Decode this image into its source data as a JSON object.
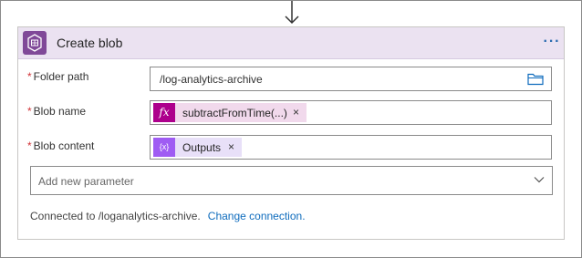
{
  "action": {
    "title": "Create blob",
    "icon": "storage-blob-icon",
    "menu_icon": "ellipsis-icon",
    "menu_label": "···"
  },
  "parameters": [
    {
      "required_marker": "*",
      "label": "Folder path",
      "value": "/log-analytics-archive",
      "icon": "folder-browse-icon"
    },
    {
      "required_marker": "*",
      "label": "Blob name",
      "token": {
        "kind": "expression",
        "icon": "fx-icon",
        "badge": "fx",
        "label": "subtractFromTime(...)",
        "remove_label": "×"
      }
    },
    {
      "required_marker": "*",
      "label": "Blob content",
      "token": {
        "kind": "variable",
        "icon": "variable-icon",
        "badge": "{x}",
        "label": "Outputs",
        "remove_label": "×"
      }
    }
  ],
  "add_parameter": {
    "placeholder": "Add new parameter",
    "icon": "chevron-down-icon"
  },
  "connection": {
    "text": "Connected to /loganalytics-archive.",
    "change_link": "Change connection."
  },
  "colors": {
    "header_bg": "#ebe2f1",
    "brand_icon": "#804998",
    "expression_token": "#ad008c",
    "variable_token": "#9f5cf3",
    "link": "#0f6cbd",
    "required": "#d13438"
  }
}
